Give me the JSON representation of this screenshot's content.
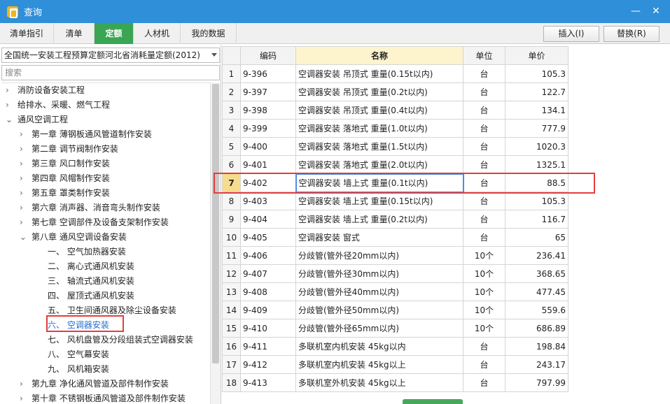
{
  "window": {
    "title": "查询",
    "min_glyph": "—",
    "close_glyph": "✕"
  },
  "tabs": [
    {
      "label": "清单指引",
      "active": false
    },
    {
      "label": "清单",
      "active": false
    },
    {
      "label": "定额",
      "active": true
    },
    {
      "label": "人材机",
      "active": false
    },
    {
      "label": "我的数据",
      "active": false
    }
  ],
  "actions": {
    "insert": "插入(I)",
    "replace": "替换(R)"
  },
  "library": {
    "selected": "全国统一安装工程预算定额河北省消耗量定额(2012)"
  },
  "search": {
    "placeholder": "搜索",
    "value": ""
  },
  "tree": [
    {
      "label": "消防设备安装工程",
      "level": 0,
      "expanded": false
    },
    {
      "label": "给排水、采暖、燃气工程",
      "level": 0,
      "expanded": false
    },
    {
      "label": "通风空调工程",
      "level": 0,
      "expanded": true
    },
    {
      "label": "第一章  薄钢板通风管道制作安装",
      "level": 1,
      "expanded": false
    },
    {
      "label": "第二章  调节阀制作安装",
      "level": 1,
      "expanded": false
    },
    {
      "label": "第三章  风口制作安装",
      "level": 1,
      "expanded": false
    },
    {
      "label": "第四章  风帽制作安装",
      "level": 1,
      "expanded": false
    },
    {
      "label": "第五章  罩类制作安装",
      "level": 1,
      "expanded": false
    },
    {
      "label": "第六章  消声器、消音弯头制作安装",
      "level": 1,
      "expanded": false
    },
    {
      "label": "第七章  空调部件及设备支架制作安装",
      "level": 1,
      "expanded": false
    },
    {
      "label": "第八章  通风空调设备安装",
      "level": 1,
      "expanded": true
    },
    {
      "label": "一、  空气加热器安装",
      "level": 2
    },
    {
      "label": "二、  离心式通风机安装",
      "level": 2
    },
    {
      "label": "三、  轴流式通风机安装",
      "level": 2
    },
    {
      "label": "四、  屋顶式通风机安装",
      "level": 2
    },
    {
      "label": "五、  卫生间通风器及除尘设备安装",
      "level": 2
    },
    {
      "label": "六、  空调器安装",
      "level": 2,
      "selected": true
    },
    {
      "label": "七、  风机盘管及分段组装式空调器安装",
      "level": 2
    },
    {
      "label": "八、  空气幕安装",
      "level": 2
    },
    {
      "label": "九、  风机箱安装",
      "level": 2
    },
    {
      "label": "第九章  净化通风管道及部件制作安装",
      "level": 1,
      "expanded": false
    },
    {
      "label": "第十章  不锈钢板通风管道及部件制作安装",
      "level": 1,
      "expanded": false
    }
  ],
  "table": {
    "columns": [
      "",
      "编码",
      "名称",
      "单位",
      "单价"
    ],
    "rows": [
      {
        "idx": "1",
        "code": "9-396",
        "name": "空调器安装 吊顶式 重量(0.15t以内)",
        "unit": "台",
        "price": "105.3"
      },
      {
        "idx": "2",
        "code": "9-397",
        "name": "空调器安装 吊顶式 重量(0.2t以内)",
        "unit": "台",
        "price": "122.7"
      },
      {
        "idx": "3",
        "code": "9-398",
        "name": "空调器安装 吊顶式 重量(0.4t以内)",
        "unit": "台",
        "price": "134.1"
      },
      {
        "idx": "4",
        "code": "9-399",
        "name": "空调器安装 落地式 重量(1.0t以内)",
        "unit": "台",
        "price": "777.9"
      },
      {
        "idx": "5",
        "code": "9-400",
        "name": "空调器安装 落地式 重量(1.5t以内)",
        "unit": "台",
        "price": "1020.3"
      },
      {
        "idx": "6",
        "code": "9-401",
        "name": "空调器安装 落地式 重量(2.0t以内)",
        "unit": "台",
        "price": "1325.1"
      },
      {
        "idx": "7",
        "code": "9-402",
        "name": "空调器安装 墙上式 重量(0.1t以内)",
        "unit": "台",
        "price": "88.5"
      },
      {
        "idx": "8",
        "code": "9-403",
        "name": "空调器安装 墙上式 重量(0.15t以内)",
        "unit": "台",
        "price": "105.3"
      },
      {
        "idx": "9",
        "code": "9-404",
        "name": "空调器安装 墙上式 重量(0.2t以内)",
        "unit": "台",
        "price": "116.7"
      },
      {
        "idx": "10",
        "code": "9-405",
        "name": "空调器安装 窗式",
        "unit": "台",
        "price": "65"
      },
      {
        "idx": "11",
        "code": "9-406",
        "name": "分歧管(管外径20mm以内)",
        "unit": "10个",
        "price": "236.41"
      },
      {
        "idx": "12",
        "code": "9-407",
        "name": "分歧管(管外径30mm以内)",
        "unit": "10个",
        "price": "368.65"
      },
      {
        "idx": "13",
        "code": "9-408",
        "name": "分歧管(管外径40mm以内)",
        "unit": "10个",
        "price": "477.45"
      },
      {
        "idx": "14",
        "code": "9-409",
        "name": "分歧管(管外径50mm以内)",
        "unit": "10个",
        "price": "559.6"
      },
      {
        "idx": "15",
        "code": "9-410",
        "name": "分歧管(管外径65mm以内)",
        "unit": "10个",
        "price": "686.89"
      },
      {
        "idx": "16",
        "code": "9-411",
        "name": "多联机室内机安装 45kg以内",
        "unit": "台",
        "price": "198.84"
      },
      {
        "idx": "17",
        "code": "9-412",
        "name": "多联机室内机安装 45kg以上",
        "unit": "台",
        "price": "243.17"
      },
      {
        "idx": "18",
        "code": "9-413",
        "name": "多联机室外机安装 45kg以上",
        "unit": "台",
        "price": "797.99"
      }
    ],
    "current_row": 7
  },
  "colors": {
    "titlebar": "#2f8fd8",
    "active_tab": "#3aa653",
    "annotation": "#e43d3d",
    "link": "#1d6fd6"
  }
}
